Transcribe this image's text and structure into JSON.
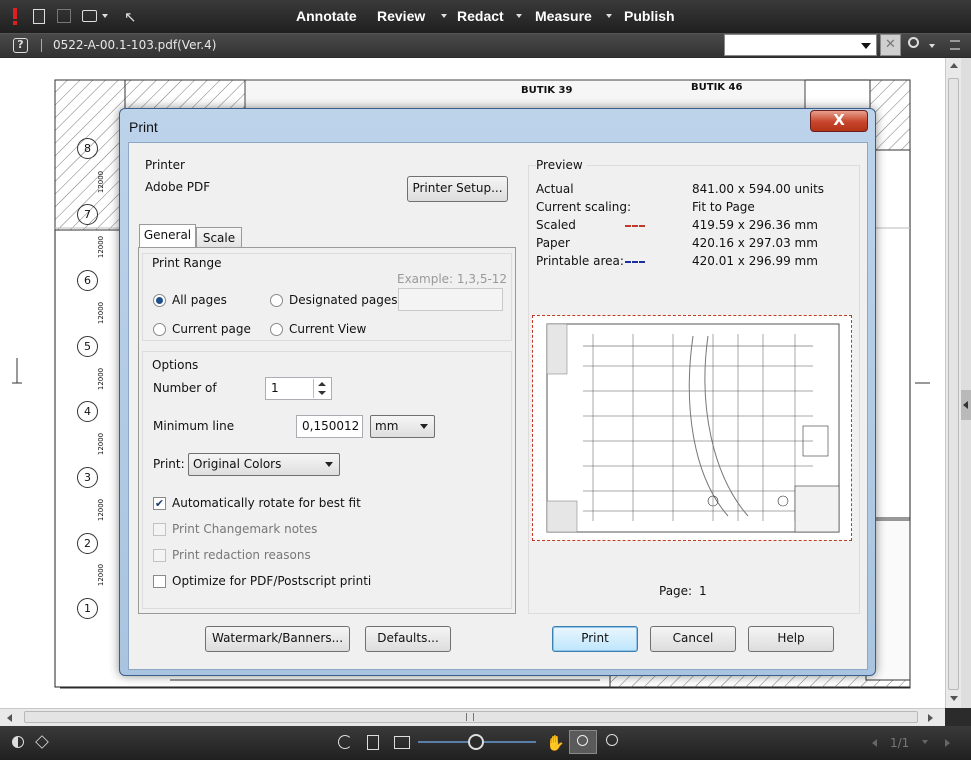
{
  "toolbar": {
    "menus": [
      {
        "label": "Annotate",
        "has_dropdown": false
      },
      {
        "label": "Review",
        "has_dropdown": true
      },
      {
        "label": "Redact",
        "has_dropdown": true
      },
      {
        "label": "Measure",
        "has_dropdown": true
      },
      {
        "label": "Publish",
        "has_dropdown": false
      }
    ]
  },
  "tabbar": {
    "document_title": "0522-A-00.1-103.pdf(Ver.4)"
  },
  "drawing": {
    "butik_labels": [
      "BUTIK 39",
      "BUTIK 46"
    ],
    "grid_labels": [
      "8",
      "7",
      "6",
      "5",
      "4",
      "3",
      "2",
      "1"
    ],
    "dimension_labels": [
      "12000",
      "12000",
      "12000",
      "12000",
      "12000",
      "12000",
      "12000"
    ]
  },
  "dialog": {
    "title": "Print",
    "close_label": "X",
    "printer": {
      "group_label": "Printer",
      "name": "Adobe PDF",
      "setup_button": "Printer Setup..."
    },
    "tabs": [
      {
        "label": "General",
        "active": true
      },
      {
        "label": "Scale",
        "active": false
      }
    ],
    "print_range": {
      "group_label": "Print Range",
      "example_hint": "Example: 1,3,5-12",
      "all_pages": "All pages",
      "designated_pages": "Designated pages:",
      "current_page": "Current page",
      "current_view": "Current View",
      "selected": "all_pages",
      "designated_value": ""
    },
    "options": {
      "group_label": "Options",
      "number_of_label": "Number of",
      "number_of_value": "1",
      "min_line_label": "Minimum line",
      "min_line_value": "0,150012",
      "min_line_unit": "mm",
      "print_label": "Print:",
      "print_value": "Original Colors",
      "auto_rotate": {
        "label": "Automatically rotate for best fit",
        "checked": true,
        "enabled": true
      },
      "changemark": {
        "label": "Print Changemark notes",
        "checked": false,
        "enabled": false
      },
      "redaction": {
        "label": "Print redaction reasons",
        "checked": false,
        "enabled": false
      },
      "optimize": {
        "label": "Optimize for PDF/Postscript printing",
        "checked": false,
        "enabled": true
      }
    },
    "preview": {
      "group_label": "Preview",
      "rows": [
        {
          "label": "Actual",
          "value": "841.00 x 594.00 units"
        },
        {
          "label": "Current scaling:",
          "value": "Fit to Page"
        },
        {
          "label": "Scaled",
          "value": "419.59 x 296.36 mm"
        },
        {
          "label": "Paper",
          "value": "420.16 x 297.03 mm"
        },
        {
          "label": "Printable area:",
          "value": "420.01 x 296.99 mm"
        }
      ],
      "scaled_line_color": "#c0392b",
      "printable_line_color": "#1c2fa0",
      "page_label": "Page:",
      "page_value": "1"
    },
    "buttons": {
      "watermark": "Watermark/Banners...",
      "defaults": "Defaults...",
      "print": "Print",
      "cancel": "Cancel",
      "help": "Help"
    }
  },
  "statusbar": {
    "page_indicator": "1/1"
  },
  "colors": {
    "toolbar_bg": "#2a2a2a",
    "dialog_frame": "#b3cce6",
    "close_red": "#c8442b",
    "primary_button_border": "#3c7fb1"
  }
}
